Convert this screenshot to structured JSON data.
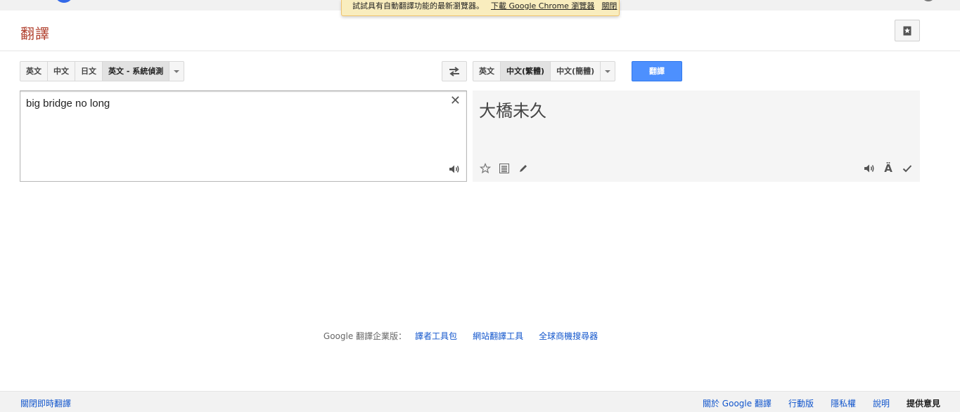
{
  "notice": {
    "message": "試試具有自動翻譯功能的最新瀏覽器。",
    "download_link": "下載 Google Chrome 瀏覽器",
    "close_link": "關閉"
  },
  "header": {
    "title": "翻譯"
  },
  "source_languages": {
    "items": [
      "英文",
      "中文",
      "日文",
      "英文 - 系統偵測"
    ],
    "selected": "英文 - 系統偵測"
  },
  "target_languages": {
    "items": [
      "英文",
      "中文(繁體)",
      "中文(簡體)"
    ],
    "selected": "中文(繁體)"
  },
  "translate_button": "翻譯",
  "source": {
    "text": "big bridge no long"
  },
  "result": {
    "text": "大橋未久"
  },
  "enterprise": {
    "label": "Google 翻譯企業版：",
    "links": [
      "譯者工具包",
      "網站翻譯工具",
      "全球商機搜尋器"
    ]
  },
  "footer": {
    "left_link": "關閉即時翻譯",
    "links": [
      "關於 Google 翻譯",
      "行動版",
      "隱私權",
      "說明"
    ],
    "feedback": "提供意見"
  },
  "colors": {
    "accent": "#4d90fe",
    "title": "#b1412f",
    "link": "#1155cc",
    "notice_bg": "#f9edbe"
  }
}
